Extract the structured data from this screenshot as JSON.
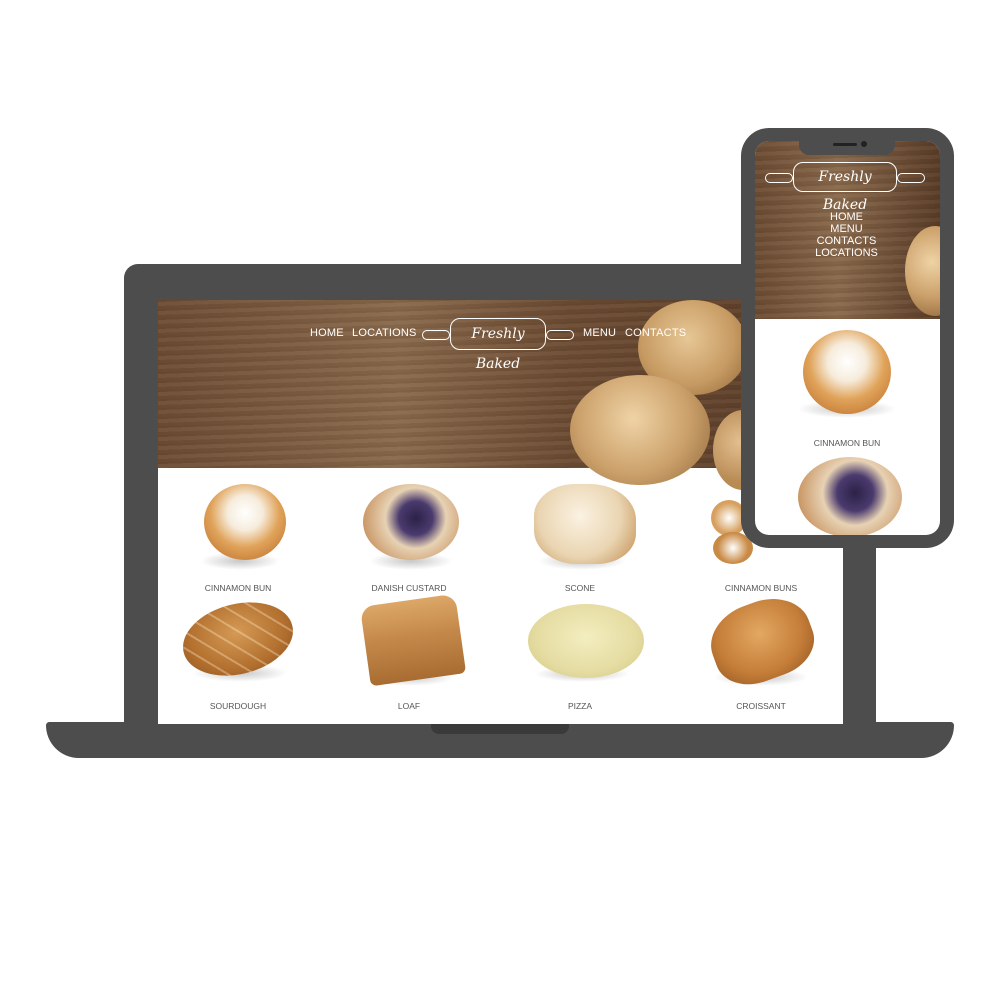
{
  "brand": {
    "logo_text": "Freshly Baked"
  },
  "desktop": {
    "nav": {
      "home": "HOME",
      "locations": "LOCATIONS",
      "menu": "MENU",
      "contacts": "CONTACTS"
    },
    "products": [
      {
        "label": "CINNAMON BUN"
      },
      {
        "label": "DANISH CUSTARD"
      },
      {
        "label": "SCONE"
      },
      {
        "label": "CINNAMON BUNS"
      },
      {
        "label": "SOURDOUGH"
      },
      {
        "label": "LOAF"
      },
      {
        "label": "PIZZA"
      },
      {
        "label": "CROISSANT"
      }
    ]
  },
  "mobile": {
    "nav": {
      "home": "HOME",
      "menu": "MENU",
      "contacts": "CONTACTS",
      "locations": "LOCATIONS"
    },
    "products": [
      {
        "label": "CINNAMON BUN"
      }
    ]
  },
  "colors": {
    "device_frame": "#4d4d4d",
    "wood": "#7a5a3f",
    "label_text": "#555555",
    "nav_text": "#ffffff"
  },
  "icons": [
    "rolling-pin-logo-icon"
  ]
}
